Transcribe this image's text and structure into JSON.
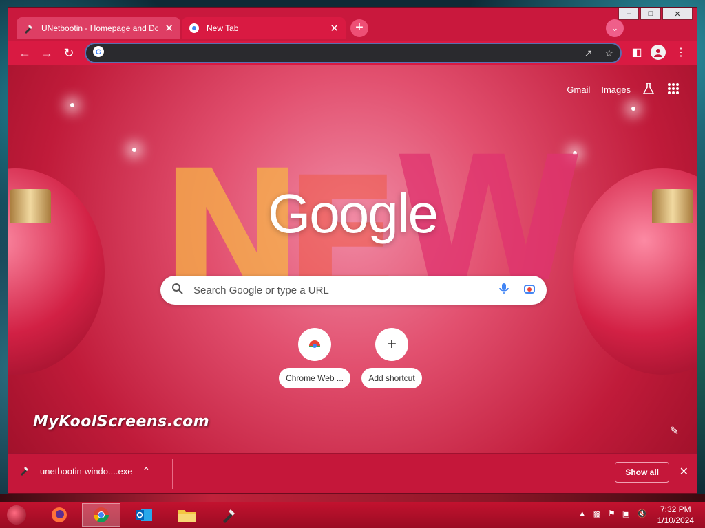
{
  "browser": {
    "tabs": [
      {
        "title": "UNetbootin - Homepage and Do",
        "active": false,
        "favicon": "unetbootin-icon"
      },
      {
        "title": "New Tab",
        "active": true,
        "favicon": "chrome-icon"
      }
    ],
    "omnibox": {
      "value": "",
      "placeholder": ""
    },
    "accent": "#d91a42"
  },
  "newtab": {
    "links": {
      "gmail": "Gmail",
      "images": "Images"
    },
    "logo": "Google",
    "search_placeholder": "Search Google or type a URL",
    "shortcuts": [
      {
        "label": "Chrome Web ...",
        "icon": "chrome-web-store-icon"
      },
      {
        "label": "Add shortcut",
        "icon": "plus-icon"
      }
    ],
    "watermark": "MyKoolScreens.com"
  },
  "download_bar": {
    "filename": "unetbootin-windo....exe",
    "show_all": "Show all"
  },
  "taskbar": {
    "time": "7:32 PM",
    "date": "1/10/2024",
    "apps": [
      "firefox-icon",
      "chrome-icon",
      "outlook-icon",
      "file-explorer-icon",
      "unetbootin-icon"
    ]
  }
}
